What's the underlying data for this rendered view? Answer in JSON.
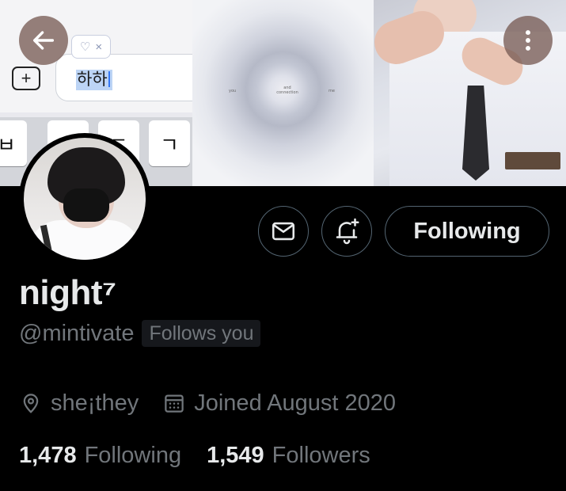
{
  "banner": {
    "back_icon": "arrow-left-icon",
    "more_icon": "more-vertical-icon",
    "keyboard": {
      "typed_text": "하하",
      "chip_icon": "heart-outline-icon",
      "chip_close": "×",
      "plus_label": "+",
      "keys": [
        "ㅂ",
        "",
        "ㄷ",
        "ㄱ"
      ]
    },
    "middle_text": {
      "left": "you",
      "center": "and connection",
      "right": "me"
    }
  },
  "profile": {
    "display_name": "night⁷",
    "handle": "@mintivate",
    "follows_you": "Follows you",
    "pronouns": "she¡they",
    "joined": "Joined August 2020",
    "following_count": "1,478",
    "following_label": "Following",
    "followers_count": "1,549",
    "followers_label": "Followers"
  },
  "actions": {
    "message_icon": "mail-icon",
    "notify_icon": "bell-plus-icon",
    "follow_label": "Following"
  },
  "colors": {
    "background": "#000000",
    "primary_text": "#e7e9ea",
    "secondary_text": "#71767b",
    "border": "#536471"
  }
}
